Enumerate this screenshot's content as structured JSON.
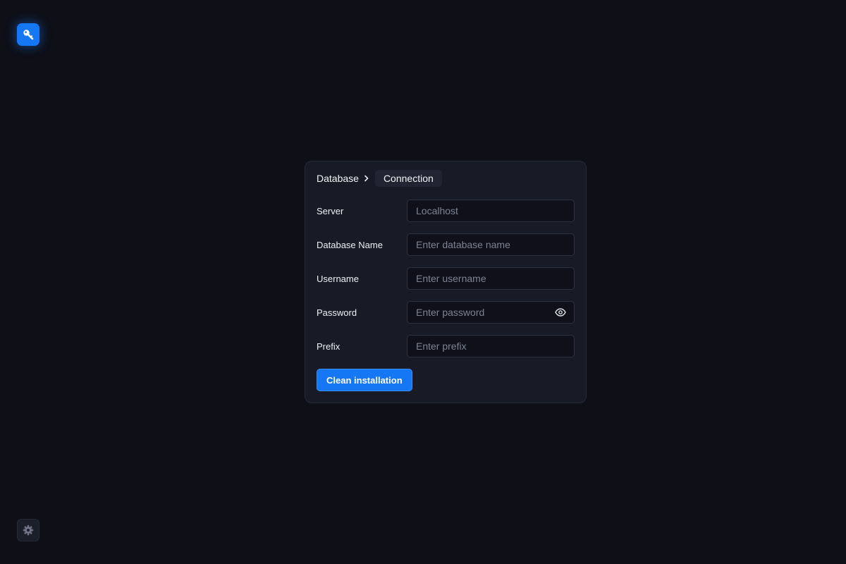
{
  "app": {
    "logo_icon": "key-icon",
    "accent_color": "#1677f5"
  },
  "breadcrumb": {
    "root": "Database",
    "current": "Connection",
    "separator_icon": "chevron-right-icon"
  },
  "form": {
    "fields": [
      {
        "label": "Server",
        "placeholder": "Localhost",
        "value": ""
      },
      {
        "label": "Database Name",
        "placeholder": "Enter database name",
        "value": ""
      },
      {
        "label": "Username",
        "placeholder": "Enter username",
        "value": ""
      },
      {
        "label": "Password",
        "placeholder": "Enter password",
        "value": "",
        "toggle_icon": "eye-icon"
      },
      {
        "label": "Prefix",
        "placeholder": "Enter prefix",
        "value": ""
      }
    ],
    "submit_label": "Clean installation"
  },
  "footer": {
    "settings_icon": "gear-icon"
  }
}
